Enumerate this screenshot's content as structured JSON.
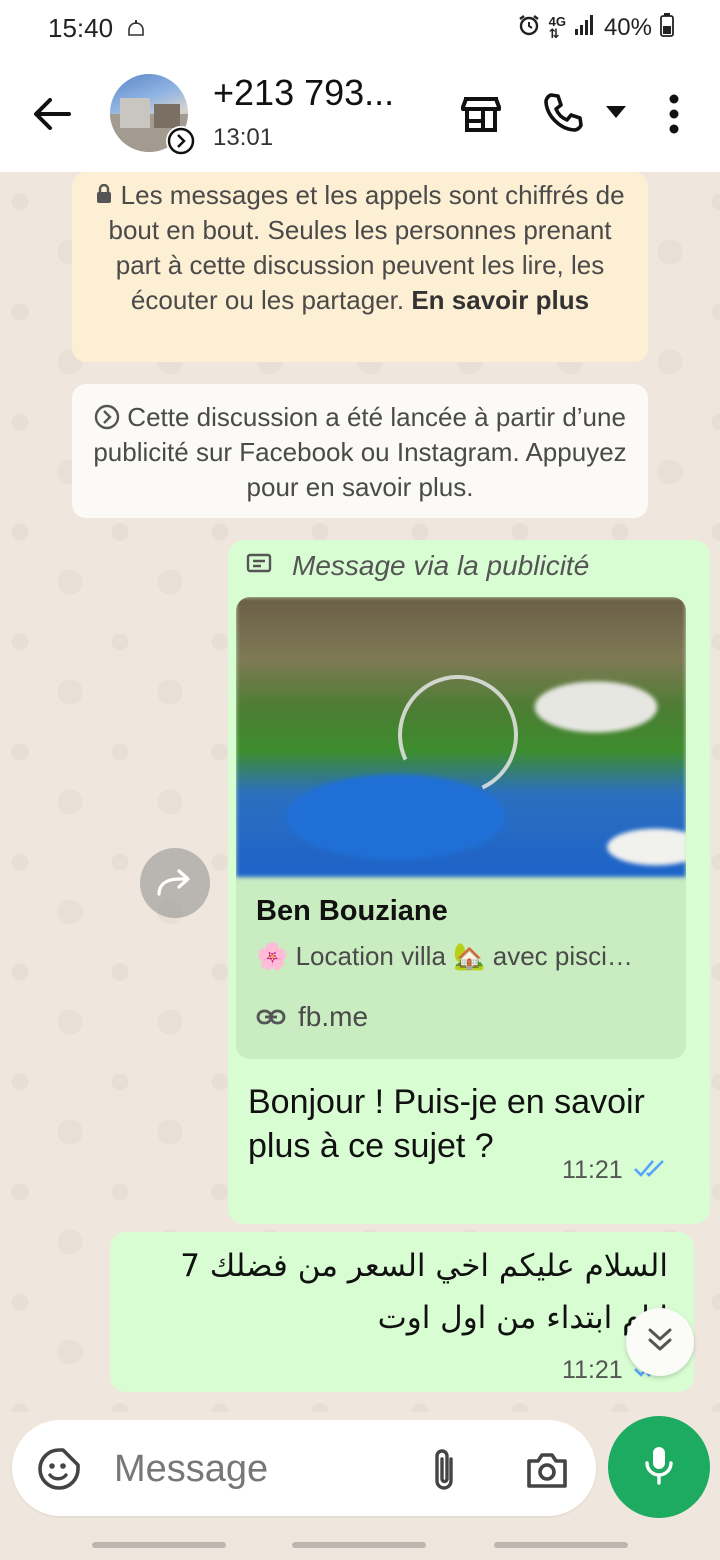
{
  "status_bar": {
    "time": "15:40",
    "battery": "40%",
    "icons": [
      "mosque-notification-icon",
      "alarm-icon",
      "4g-icon",
      "signal-icon",
      "battery-icon"
    ]
  },
  "header": {
    "contact_name": "+213 793...",
    "subtitle": "13:01",
    "icons": [
      "back-arrow-icon",
      "store-icon",
      "phone-icon",
      "dropdown-icon",
      "more-vert-icon"
    ]
  },
  "notices": {
    "encryption_text": "Les messages et les appels sont chiffrés de bout en bout. Seules les personnes prenant part à cette discussion peuvent les lire, les écouter ou les partager.",
    "encryption_link": "En savoir plus",
    "ad_notice": "Cette discussion a été lancée à partir d’une publicité sur Facebook ou Instagram. Appuyez pour en savoir plus."
  },
  "messages": [
    {
      "direction": "out",
      "ad_label": "Message via la publicité",
      "ad_card": {
        "title": "Ben Bouziane",
        "description": "🌸 Location villa 🏡 avec pisci…",
        "link": "fb.me"
      },
      "text": "Bonjour ! Puis-je en savoir plus à ce sujet ?",
      "time": "11:21",
      "status": "read"
    },
    {
      "direction": "out",
      "text": "السلام عليكم اخي السعر من فضلك 7 ايام ابتداء من اول اوت",
      "time": "11:21",
      "status": "read"
    }
  ],
  "composer": {
    "placeholder": "Message"
  },
  "colors": {
    "outgoing_bubble": "#d9fdd3",
    "encryption_bg": "#fcefd3",
    "chat_bg": "#efe7de",
    "accent_green": "#1daa61",
    "read_ticks": "#53a6fd"
  }
}
